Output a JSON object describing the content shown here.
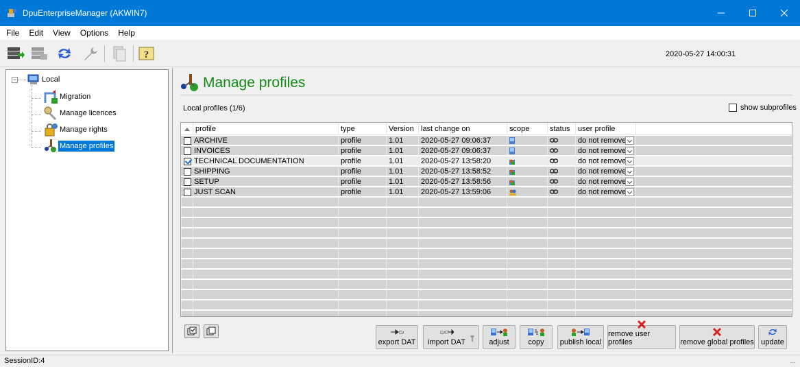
{
  "window": {
    "title": "DpuEnterpriseManager (AKWIN7)"
  },
  "menu": [
    "File",
    "Edit",
    "View",
    "Options",
    "Help"
  ],
  "toolbar": {
    "clock": "2020-05-27 14:00:31",
    "icons": [
      "database-connect-icon",
      "database-disconnect-icon",
      "refresh-icon",
      "wrench-icon",
      "document-icon",
      "help-icon"
    ]
  },
  "tree": {
    "root": "Local",
    "items": [
      "Migration",
      "Manage licences",
      "Manage rights",
      "Manage profiles"
    ],
    "selected": "Manage profiles"
  },
  "main": {
    "title": "Manage profiles",
    "count_label": "Local profiles (1/6)",
    "show_subprofiles": "show subprofiles"
  },
  "table": {
    "columns": [
      "profile",
      "type",
      "Version",
      "last change on",
      "scope",
      "status",
      "user profile"
    ],
    "rows": [
      {
        "name": "ARCHIVE",
        "type": "profile",
        "version": "1.01",
        "changed": "2020-05-27 09:06:37",
        "user_profile": "do not remove",
        "checked": false
      },
      {
        "name": "INVOICES",
        "type": "profile",
        "version": "1.01",
        "changed": "2020-05-27 09:06:37",
        "user_profile": "do not remove",
        "checked": false
      },
      {
        "name": "TECHNICAL DOCUMENTATION",
        "type": "profile",
        "version": "1.01",
        "changed": "2020-05-27 13:58:20",
        "user_profile": "do not remove",
        "checked": true
      },
      {
        "name": "SHIPPING",
        "type": "profile",
        "version": "1.01",
        "changed": "2020-05-27 13:58:52",
        "user_profile": "do not remove",
        "checked": false
      },
      {
        "name": "SETUP",
        "type": "profile",
        "version": "1.01",
        "changed": "2020-05-27 13:58:56",
        "user_profile": "do not remove",
        "checked": false
      },
      {
        "name": "JUST SCAN",
        "type": "profile",
        "version": "1.01",
        "changed": "2020-05-27 13:59:06",
        "user_profile": "do not remove",
        "checked": false
      }
    ]
  },
  "buttons": {
    "export_dat": "export DAT",
    "import_dat": "import DAT",
    "adjust": "adjust",
    "copy": "copy",
    "publish_local": "publish local",
    "remove_user_profiles": "remove user profiles",
    "remove_global_profiles": "remove global profiles",
    "update": "update"
  },
  "status": {
    "session": "SessionID:4",
    "grip": "..."
  },
  "colors": {
    "titlebar": "#0078d7",
    "accent_green": "#128c16",
    "selection": "#0078d7",
    "remove_red": "#d82020"
  }
}
